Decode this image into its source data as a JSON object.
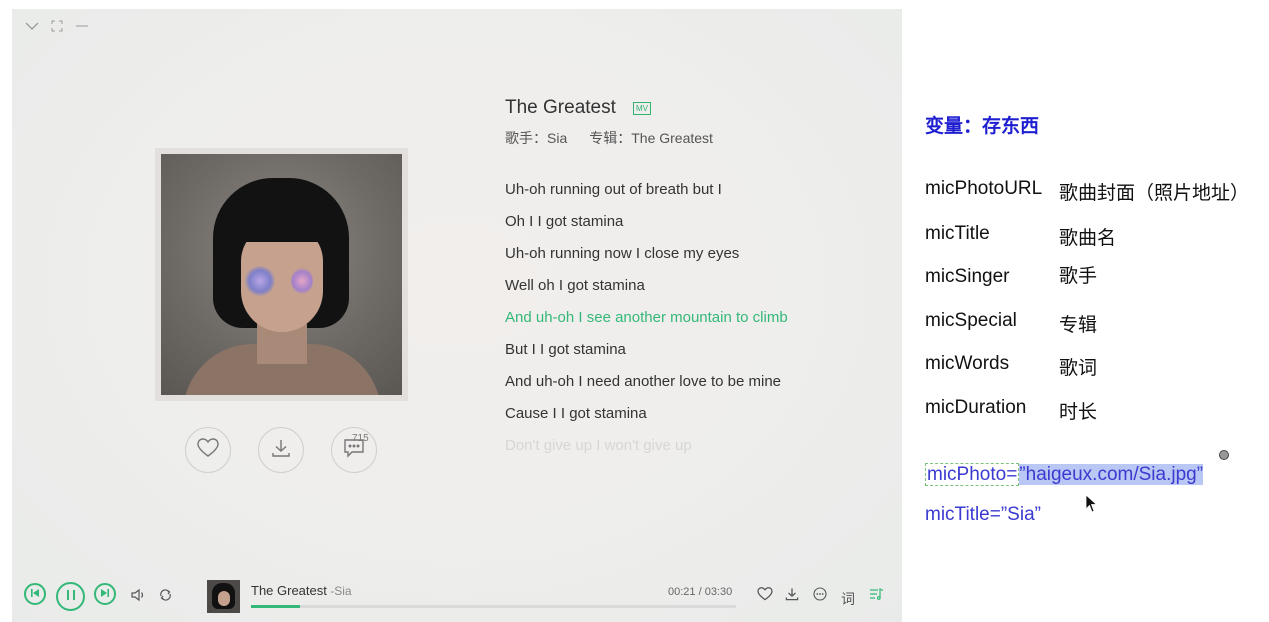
{
  "player": {
    "song": {
      "title": "The Greatest",
      "mv_badge": "MV",
      "singer_label": "歌手：Sia",
      "album_label": "专辑：The Greatest"
    },
    "lyrics": [
      {
        "text": "Uh-oh running out of breath but I",
        "active": false
      },
      {
        "text": "Oh I I got stamina",
        "active": false
      },
      {
        "text": "Uh-oh running now I close my eyes",
        "active": false
      },
      {
        "text": "Well oh I got stamina",
        "active": false
      },
      {
        "text": "And uh-oh I see another mountain to climb",
        "active": true
      },
      {
        "text": "But I I got stamina",
        "active": false
      },
      {
        "text": "And uh-oh I need another love to be mine",
        "active": false
      },
      {
        "text": "Cause I I got stamina",
        "active": false
      },
      {
        "text": "Don't give up I won't give up",
        "active": false,
        "faded": true
      }
    ],
    "actions": {
      "comment_count": "715"
    },
    "now_playing": {
      "title": "The Greatest",
      "artist": " -Sia",
      "time": "00:21 / 03:30",
      "progress": 0.1
    },
    "lyric_toggle": "词",
    "accent_color": "#33b877"
  },
  "notes": {
    "title": "变量：存东西",
    "variables": [
      {
        "name": "micPhotoURL",
        "desc": "歌曲封面（照片地址）"
      },
      {
        "name": "micTitle",
        "desc": "歌曲名"
      },
      {
        "name": "micSinger",
        "desc": "歌手"
      },
      {
        "name": "micSpecial",
        "desc": "专辑"
      },
      {
        "name": "micWords",
        "desc": "歌词"
      },
      {
        "name": "micDuration",
        "desc": "时长"
      }
    ],
    "code": [
      {
        "key": "micPhoto=",
        "value": "”haigeux.com/Sia.jpg”"
      },
      {
        "key": "micTitle=",
        "value": "”Sia”"
      }
    ]
  }
}
